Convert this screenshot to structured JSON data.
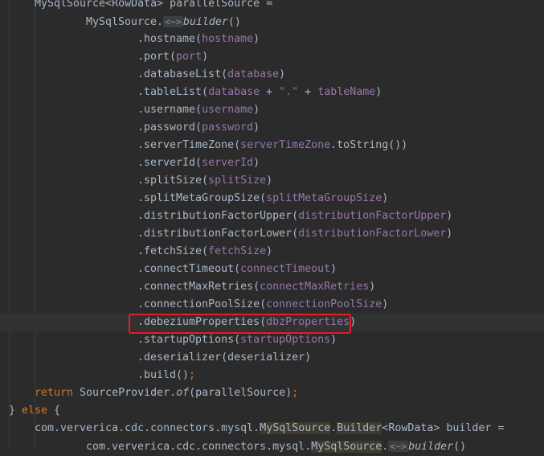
{
  "editor": {
    "lines": [
      {
        "indent": 43,
        "tokens": [
          {
            "t": "MySqlSource<RowData> parallelSource =",
            "c": "plain"
          }
        ]
      },
      {
        "indent": 107,
        "tokens": [
          {
            "t": "MySqlSource.",
            "c": "plain"
          },
          {
            "t": "<~>",
            "c": "hint"
          },
          {
            "t": "builder",
            "c": "italic"
          },
          {
            "t": "()",
            "c": "plain"
          }
        ]
      },
      {
        "indent": 171,
        "tokens": [
          {
            "t": ".hostname(",
            "c": "plain"
          },
          {
            "t": "hostname",
            "c": "field"
          },
          {
            "t": ")",
            "c": "plain"
          }
        ]
      },
      {
        "indent": 171,
        "tokens": [
          {
            "t": ".port(",
            "c": "plain"
          },
          {
            "t": "port",
            "c": "field"
          },
          {
            "t": ")",
            "c": "plain"
          }
        ]
      },
      {
        "indent": 171,
        "tokens": [
          {
            "t": ".databaseList(",
            "c": "plain"
          },
          {
            "t": "database",
            "c": "field"
          },
          {
            "t": ")",
            "c": "plain"
          }
        ]
      },
      {
        "indent": 171,
        "tokens": [
          {
            "t": ".tableList(",
            "c": "plain"
          },
          {
            "t": "database",
            "c": "field"
          },
          {
            "t": " + ",
            "c": "plain"
          },
          {
            "t": "\".\"",
            "c": "str"
          },
          {
            "t": " + ",
            "c": "plain"
          },
          {
            "t": "tableName",
            "c": "field"
          },
          {
            "t": ")",
            "c": "plain"
          }
        ]
      },
      {
        "indent": 171,
        "tokens": [
          {
            "t": ".username(",
            "c": "plain"
          },
          {
            "t": "username",
            "c": "field"
          },
          {
            "t": ")",
            "c": "plain"
          }
        ]
      },
      {
        "indent": 171,
        "tokens": [
          {
            "t": ".password(",
            "c": "plain"
          },
          {
            "t": "password",
            "c": "field"
          },
          {
            "t": ")",
            "c": "plain"
          }
        ]
      },
      {
        "indent": 171,
        "tokens": [
          {
            "t": ".serverTimeZone(",
            "c": "plain"
          },
          {
            "t": "serverTimeZone",
            "c": "field"
          },
          {
            "t": ".toString())",
            "c": "plain"
          }
        ]
      },
      {
        "indent": 171,
        "tokens": [
          {
            "t": ".serverId(",
            "c": "plain"
          },
          {
            "t": "serverId",
            "c": "field"
          },
          {
            "t": ")",
            "c": "plain"
          }
        ]
      },
      {
        "indent": 171,
        "tokens": [
          {
            "t": ".splitSize(",
            "c": "plain"
          },
          {
            "t": "splitSize",
            "c": "field"
          },
          {
            "t": ")",
            "c": "plain"
          }
        ]
      },
      {
        "indent": 171,
        "tokens": [
          {
            "t": ".splitMetaGroupSize(",
            "c": "plain"
          },
          {
            "t": "splitMetaGroupSize",
            "c": "field"
          },
          {
            "t": ")",
            "c": "plain"
          }
        ]
      },
      {
        "indent": 171,
        "tokens": [
          {
            "t": ".distributionFactorUpper(",
            "c": "plain"
          },
          {
            "t": "distributionFactorUpper",
            "c": "field"
          },
          {
            "t": ")",
            "c": "plain"
          }
        ]
      },
      {
        "indent": 171,
        "tokens": [
          {
            "t": ".distributionFactorLower(",
            "c": "plain"
          },
          {
            "t": "distributionFactorLower",
            "c": "field"
          },
          {
            "t": ")",
            "c": "plain"
          }
        ]
      },
      {
        "indent": 171,
        "tokens": [
          {
            "t": ".fetchSize(",
            "c": "plain"
          },
          {
            "t": "fetchSize",
            "c": "field"
          },
          {
            "t": ")",
            "c": "plain"
          }
        ]
      },
      {
        "indent": 171,
        "tokens": [
          {
            "t": ".connectTimeout(",
            "c": "plain"
          },
          {
            "t": "connectTimeout",
            "c": "field"
          },
          {
            "t": ")",
            "c": "plain"
          }
        ]
      },
      {
        "indent": 171,
        "tokens": [
          {
            "t": ".connectMaxRetries(",
            "c": "plain"
          },
          {
            "t": "connectMaxRetries",
            "c": "field"
          },
          {
            "t": ")",
            "c": "plain"
          }
        ]
      },
      {
        "indent": 171,
        "tokens": [
          {
            "t": ".connectionPoolSize(",
            "c": "plain"
          },
          {
            "t": "connectionPoolSize",
            "c": "field"
          },
          {
            "t": ")",
            "c": "plain"
          }
        ]
      },
      {
        "indent": 171,
        "current": true,
        "tokens": [
          {
            "t": ".debeziumProperties(",
            "c": "plain"
          },
          {
            "t": "dbzProperties",
            "c": "field"
          },
          {
            "t": ")",
            "c": "plain"
          }
        ]
      },
      {
        "indent": 171,
        "tokens": [
          {
            "t": ".startupOptions(",
            "c": "plain"
          },
          {
            "t": "startupOptions",
            "c": "field"
          },
          {
            "t": ")",
            "c": "plain"
          }
        ]
      },
      {
        "indent": 171,
        "tokens": [
          {
            "t": ".deserializer(deserializer)",
            "c": "plain"
          }
        ]
      },
      {
        "indent": 171,
        "tokens": [
          {
            "t": ".build()",
            "c": "plain"
          },
          {
            "t": ";",
            "c": "kw"
          }
        ]
      },
      {
        "indent": 43,
        "tokens": [
          {
            "t": "return ",
            "c": "kw"
          },
          {
            "t": "SourceProvider.",
            "c": "plain"
          },
          {
            "t": "of",
            "c": "italic"
          },
          {
            "t": "(parallelSource)",
            "c": "plain"
          },
          {
            "t": ";",
            "c": "kw"
          }
        ]
      },
      {
        "indent": 11,
        "tokens": [
          {
            "t": "} ",
            "c": "plain"
          },
          {
            "t": "else",
            "c": "kw"
          },
          {
            "t": " {",
            "c": "plain"
          }
        ]
      },
      {
        "indent": 43,
        "tokens": [
          {
            "t": "com.ververica.cdc.connectors.mysql.",
            "c": "plain"
          },
          {
            "t": "MySqlSource",
            "c": "hl"
          },
          {
            "t": ".",
            "c": "plain"
          },
          {
            "t": "Builder",
            "c": "hl"
          },
          {
            "t": "<RowData> builder =",
            "c": "plain"
          }
        ]
      },
      {
        "indent": 107,
        "tokens": [
          {
            "t": "com.ververica.cdc.connectors.mysql.",
            "c": "plain"
          },
          {
            "t": "MySqlSource",
            "c": "hl"
          },
          {
            "t": ".",
            "c": "plain"
          },
          {
            "t": "<~>",
            "c": "hint"
          },
          {
            "t": "builder",
            "c": "italic"
          },
          {
            "t": "()",
            "c": "plain"
          }
        ]
      }
    ]
  }
}
